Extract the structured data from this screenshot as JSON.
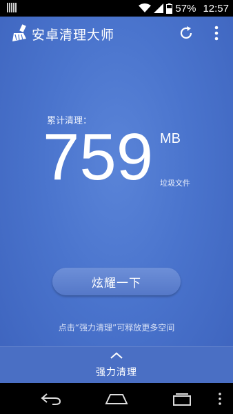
{
  "status_bar": {
    "battery_percent": "57%",
    "time": "12:57"
  },
  "toolbar": {
    "title": "安卓清理大师",
    "icons": [
      "broom-logo-icon",
      "refresh-icon",
      "more-vert-icon"
    ]
  },
  "summary": {
    "label": "累计清理：",
    "value": "759",
    "unit": "MB",
    "sublabel": "垃圾文件"
  },
  "show_button": {
    "label": "炫耀一下"
  },
  "hint": "点击“强力清理”可释放更多空间",
  "bottom_panel": {
    "label": "强力清理",
    "icon": "chevron-up-icon"
  },
  "nav_bar": {
    "icons": [
      "back-icon",
      "home-icon",
      "recents-icon",
      "menu-icon"
    ]
  },
  "colors": {
    "background": "#4a74cd",
    "button": "#5f82d0",
    "bottom_panel": "#4a6fc4"
  }
}
